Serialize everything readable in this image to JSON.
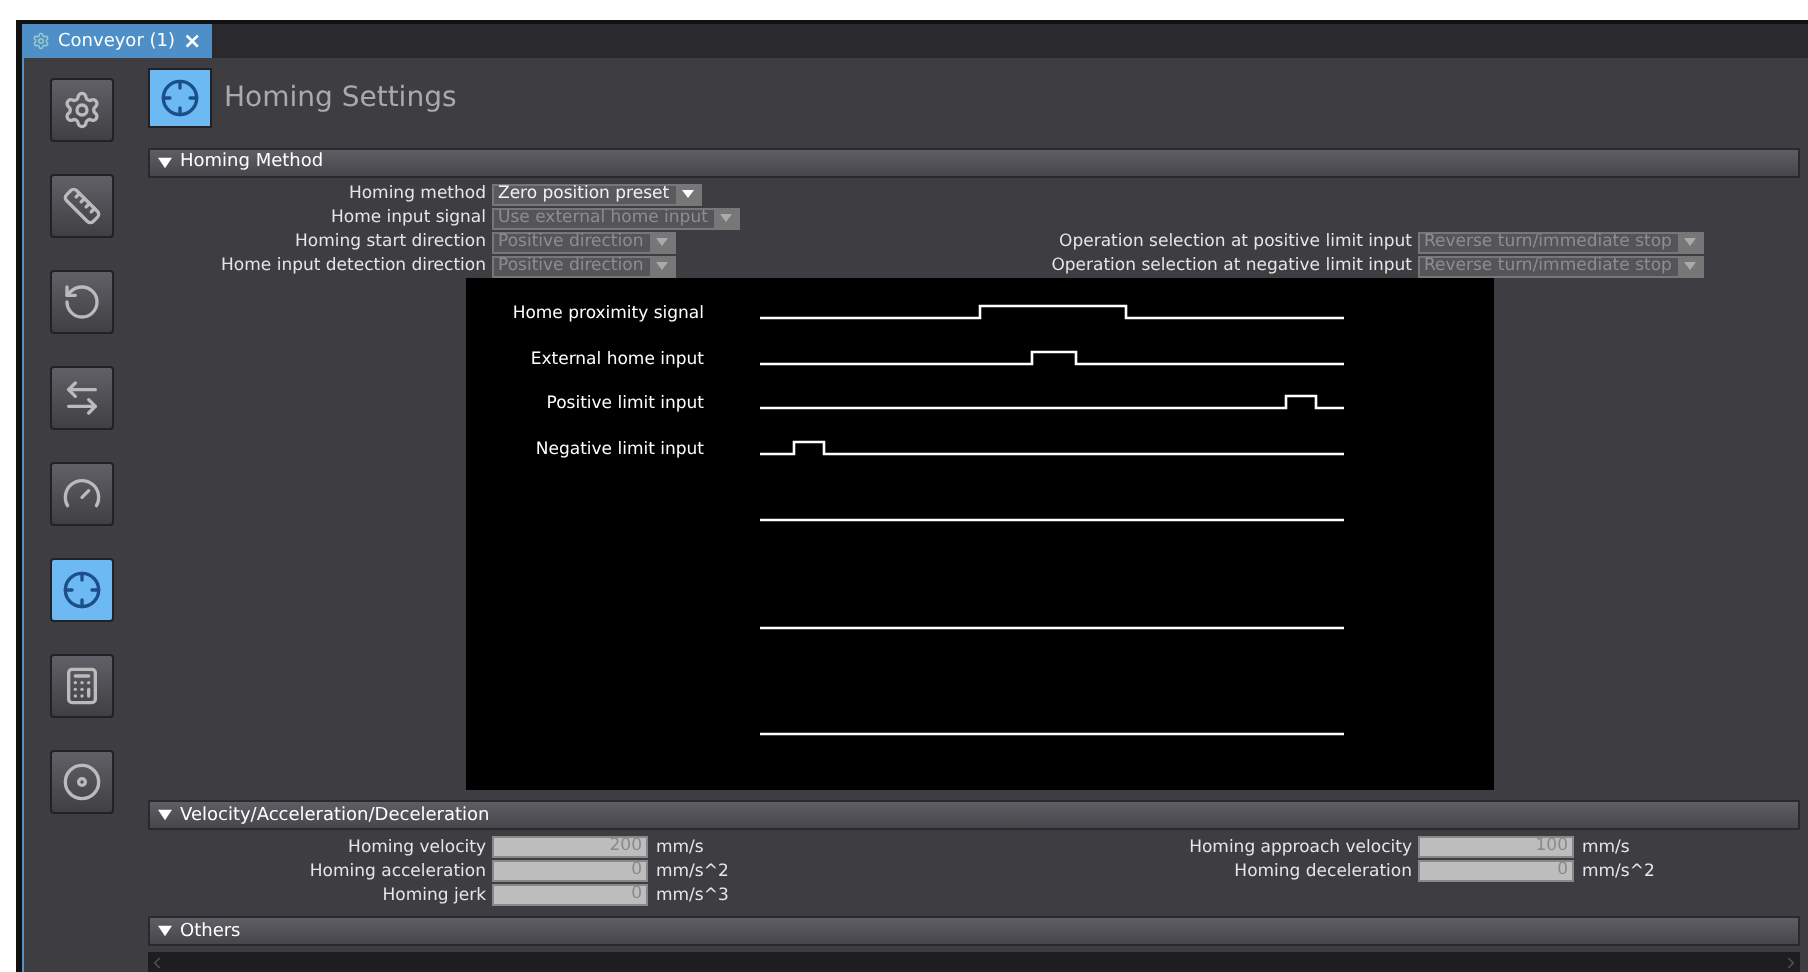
{
  "tab": {
    "title": "Conveyor (1)",
    "close": "×",
    "selected": true
  },
  "sidebar": {
    "items": [
      {
        "kind": "setup",
        "selected": false
      },
      {
        "kind": "units",
        "selected": false
      },
      {
        "kind": "rotary",
        "selected": false
      },
      {
        "kind": "transfer",
        "selected": false
      },
      {
        "kind": "gauge",
        "selected": false
      },
      {
        "kind": "homing",
        "selected": true
      },
      {
        "kind": "counter",
        "selected": false
      },
      {
        "kind": "timer",
        "selected": false
      }
    ]
  },
  "header": {
    "title": "Homing Settings"
  },
  "homing_method": {
    "title": "Homing Method",
    "expanded": true,
    "rows": [
      {
        "left": {
          "label": "Homing method",
          "value": "Zero position preset",
          "disabled": false
        }
      },
      {
        "left": {
          "label": "Home input signal",
          "value": "Use external home input",
          "disabled": true
        }
      },
      {
        "left": {
          "label": "Homing start direction",
          "value": "Positive direction",
          "disabled": true
        },
        "right": {
          "label": "Operation selection at positive limit input",
          "value": "Reverse turn/immediate stop",
          "disabled": true
        }
      },
      {
        "left": {
          "label": "Home input detection direction",
          "value": "Positive direction",
          "disabled": true
        },
        "right": {
          "label": "Operation selection at negative limit input",
          "value": "Reverse turn/immediate stop",
          "disabled": true
        }
      }
    ],
    "signals": [
      {
        "label": "Home proximity signal"
      },
      {
        "label": "External home input"
      },
      {
        "label": "Positive limit input"
      },
      {
        "label": "Negative limit input"
      }
    ]
  },
  "velocity": {
    "title": "Velocity/Acceleration/Deceleration",
    "expanded": true,
    "rows": [
      {
        "left": {
          "label": "Homing velocity",
          "value": "200",
          "unit": "mm/s",
          "disabled": true
        },
        "right": {
          "label": "Homing approach velocity",
          "value": "100",
          "unit": "mm/s",
          "disabled": true
        }
      },
      {
        "left": {
          "label": "Homing acceleration",
          "value": "0",
          "unit": "mm/s^2",
          "disabled": true
        },
        "right": {
          "label": "Homing deceleration",
          "value": "0",
          "unit": "mm/s^2",
          "disabled": true
        }
      },
      {
        "left": {
          "label": "Homing jerk",
          "value": "0",
          "unit": "mm/s^3",
          "disabled": true
        }
      }
    ]
  },
  "others": {
    "title": "Others",
    "expanded": true
  }
}
